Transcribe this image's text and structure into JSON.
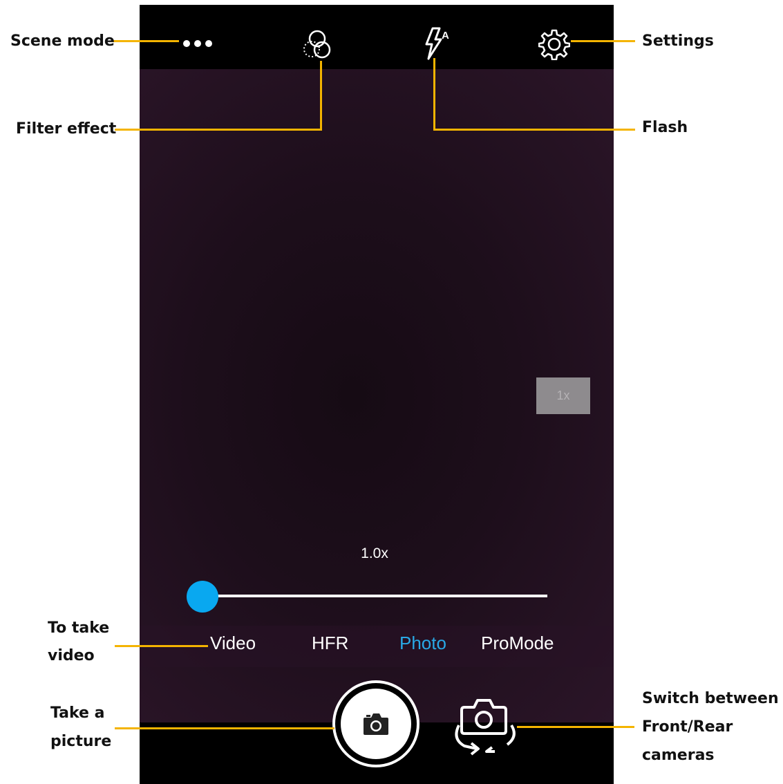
{
  "annotations": {
    "scene_mode": "Scene mode",
    "filter_effect": "Filter effect",
    "flash": "Flash",
    "settings": "Settings",
    "video_line1": "To take",
    "video_line2": "video",
    "picture_line1": "Take a",
    "picture_line2": "picture",
    "switch_line1": "Switch between",
    "switch_line2": "Front/Rear",
    "switch_line3": "cameras"
  },
  "camera": {
    "zoom_badge": "1x",
    "zoom_level": "1.0x",
    "zoom_slider_fraction": 0.0,
    "modes": [
      "Video",
      "HFR",
      "Photo",
      "ProMode"
    ],
    "active_mode": "Photo"
  },
  "colors": {
    "callout_line": "#f4b400",
    "active_mode": "#29a9e6",
    "slider_thumb": "#09a8f0"
  },
  "icons": {
    "scene_mode": "more-dots-icon",
    "filter_effect": "filter-circles-icon",
    "flash": "flash-auto-icon",
    "settings": "gear-icon",
    "shutter": "camera-icon",
    "switch_camera": "switch-camera-icon"
  }
}
